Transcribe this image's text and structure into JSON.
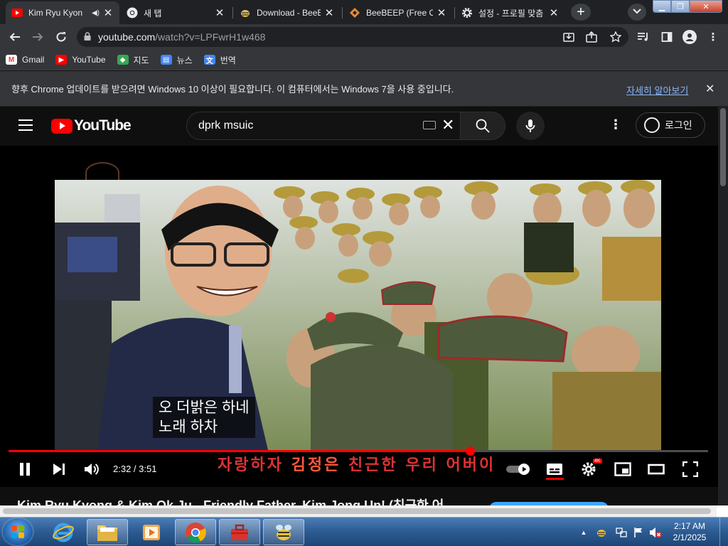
{
  "tabs": [
    {
      "title": "Kim Ryu Kyon",
      "icon": "youtube-icon",
      "active": true,
      "audio": "◀)"
    },
    {
      "title": "새 탭",
      "icon": "chrome-icon"
    },
    {
      "title": "Download - BeeB",
      "icon": "beebeep-icon"
    },
    {
      "title": "BeeBEEP (Free Of",
      "icon": "beebeep-orange-icon"
    },
    {
      "title": "설정 - 프로필 맞춤",
      "icon": "settings-gear-icon"
    }
  ],
  "tab_close_glyph": "✕",
  "new_tab_glyph": "+",
  "omnibox": {
    "host": "youtube.com",
    "path": "/watch?v=LPFwrH1w468"
  },
  "bookmarks": [
    {
      "label": "Gmail",
      "icon": "gmail-icon",
      "color": "#ea4335",
      "glyph": "M"
    },
    {
      "label": "YouTube",
      "icon": "youtube-icon",
      "color": "#ff0000",
      "glyph": "▶"
    },
    {
      "label": "지도",
      "icon": "maps-icon",
      "color": "#34a853",
      "glyph": "◆"
    },
    {
      "label": "뉴스",
      "icon": "news-icon",
      "color": "#4285f4",
      "glyph": "▤"
    },
    {
      "label": "번역",
      "icon": "translate-icon",
      "color": "#4285f4",
      "glyph": "文"
    }
  ],
  "infobar": {
    "message": "향후 Chrome 업데이트를 받으려면 Windows 10 이상이 필요합니다. 이 컴퓨터에서는 Windows 7을 사용 중입니다.",
    "link": "자세히 알아보기",
    "close": "✕"
  },
  "youtube": {
    "logo_text": "YouTube",
    "search_query": "dprk msuic",
    "login_label": "로그인",
    "subtitle_line1": "오 더밝은 하네",
    "subtitle_line2": "노래 하차",
    "burned_caption_pre": "자랑하자 ",
    "burned_caption_name": "김정은",
    "burned_caption_post": " 친근한 우리 어버이",
    "time_display": "2:32 / 3:51",
    "progress": 0.66,
    "hd_badge": "4K",
    "video_title": "Kim Ryu Kyong & Kim Ok Ju - Friendly Father, Kim Jong Un! (친근한 어"
  },
  "taskbar": {
    "clock_time": "2:17 AM",
    "clock_date": "2/1/2025",
    "tray_arrow": "▲"
  },
  "colors": {
    "accent": "#ff0000",
    "link": "#8ab4f8",
    "chrome_dark": "#202124",
    "chrome_toolbar": "#35363a"
  }
}
